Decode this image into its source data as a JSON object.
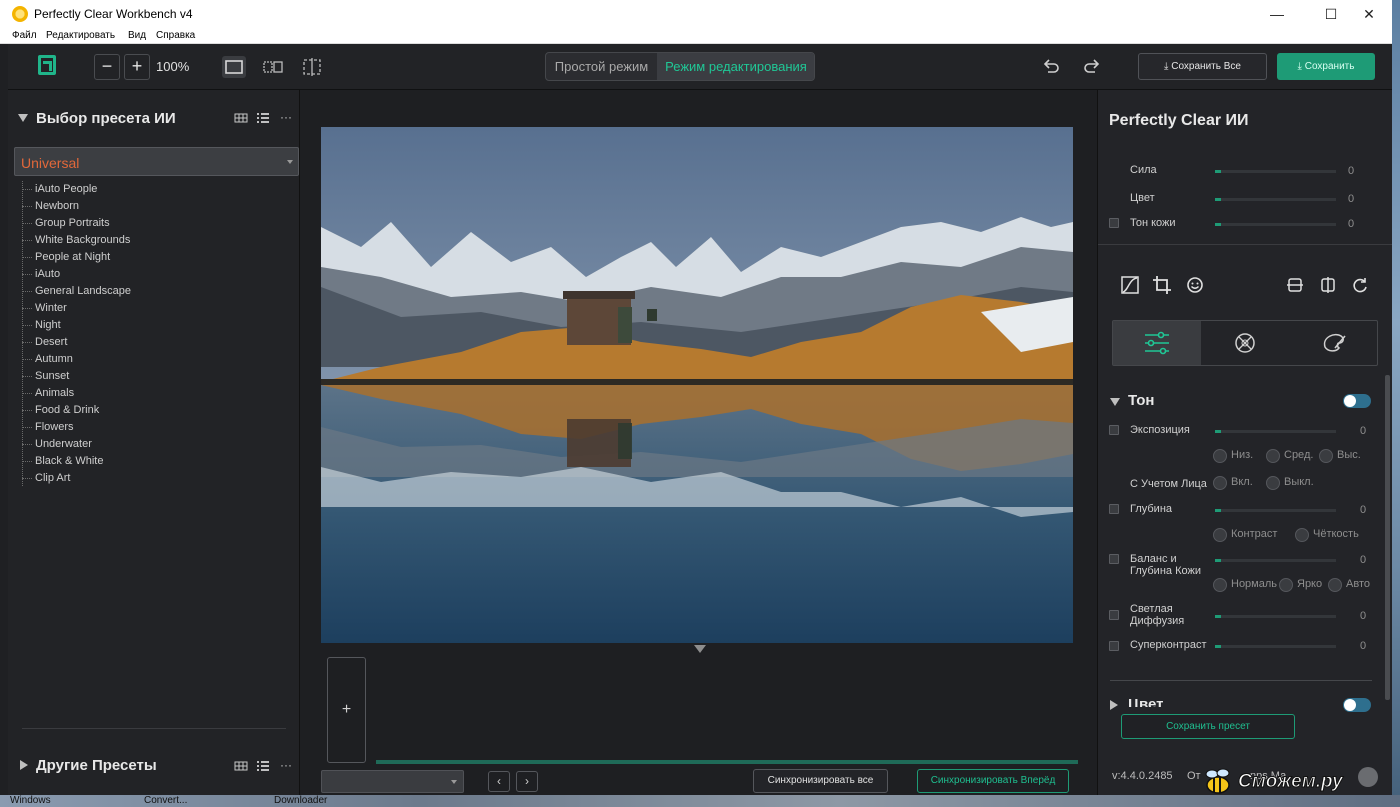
{
  "window": {
    "title": "Perfectly Clear Workbench v4",
    "minimize_glyph": "—",
    "maximize_glyph": "☐",
    "close_glyph": "✕"
  },
  "menu": [
    "Файл",
    "Редактировать",
    "Вид",
    "Справка"
  ],
  "toolbar": {
    "zoom_minus": "−",
    "zoom_plus": "+",
    "zoom_level": "100%",
    "mode_simple": "Простой режим",
    "mode_edit": "Режим редактирования",
    "save_all_label": "Сохранить Все",
    "save_label": "Сохранить"
  },
  "left_panel": {
    "title": "Выбор пресета ИИ",
    "preset_selected": "Universal",
    "presets": [
      "iAuto People",
      "Newborn",
      "Group Portraits",
      "White Backgrounds",
      "People at Night",
      "iAuto",
      "General Landscape",
      "Winter",
      "Night",
      "Desert",
      "Autumn",
      "Sunset",
      "Animals",
      "Food & Drink",
      "Flowers",
      "Underwater",
      "Black & White",
      "Clip Art"
    ],
    "other_presets_title": "Другие Пресеты",
    "more_glyph": "···"
  },
  "center": {
    "add_glyph": "+",
    "prev_glyph": "‹",
    "next_glyph": "›",
    "sync_all": "Синхронизировать все",
    "sync_forward": "Синхронизировать Вперёд"
  },
  "right_panel": {
    "title": "Perfectly Clear ИИ",
    "ai_sliders": [
      {
        "label": "Сила",
        "value": "0",
        "checkbox": false
      },
      {
        "label": "Цвет",
        "value": "0",
        "checkbox": false
      },
      {
        "label": "Тон кожи",
        "value": "0",
        "checkbox": true
      }
    ],
    "tone_section": {
      "title": "Тон",
      "exposure": {
        "label": "Экспозиция",
        "value": "0"
      },
      "exposure_opts": [
        "Низ.",
        "Сред.",
        "Выс."
      ],
      "face_aware_label": "С Учетом Лица",
      "face_aware_opts": [
        "Вкл.",
        "Выкл."
      ],
      "depth": {
        "label": "Глубина",
        "value": "0"
      },
      "depth_opts": [
        "Контраст",
        "Чёткость"
      ],
      "skin_balance": {
        "label": "Баланс и Глубина Кожи",
        "value": "0"
      },
      "skin_opts": [
        "Нормаль",
        "Ярко",
        "Авто"
      ],
      "light_diffusion": {
        "label": "Светлая Диффузия",
        "value": "0"
      },
      "supercontrast": {
        "label": "Суперконтраст",
        "value": "0"
      }
    },
    "color_section_title": "Цвет",
    "save_preset": "Сохранить пресет",
    "version": "v:4.4.0.2485",
    "footer_text_1": "От",
    "footer_text_2": "nps Ма"
  },
  "desktop": {
    "taskbar_items": [
      "Windows",
      "Convert...",
      "Downloader"
    ]
  },
  "watermark": "Сможем.ру",
  "colors": {
    "accent_green": "#1e9b76",
    "preset_orange": "#e2683a",
    "toggle_blue": "#2e6f8e"
  }
}
